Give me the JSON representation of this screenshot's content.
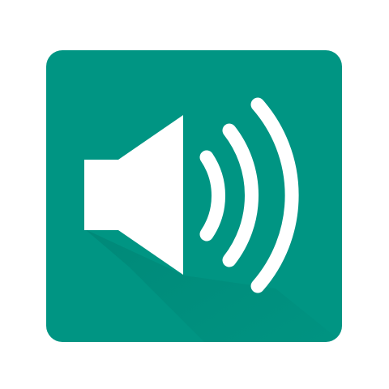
{
  "icon": {
    "name": "speaker-volume-icon",
    "background_color": "#009583",
    "shadow_color": "#007F70",
    "glyph_color": "#FFFFFF"
  }
}
